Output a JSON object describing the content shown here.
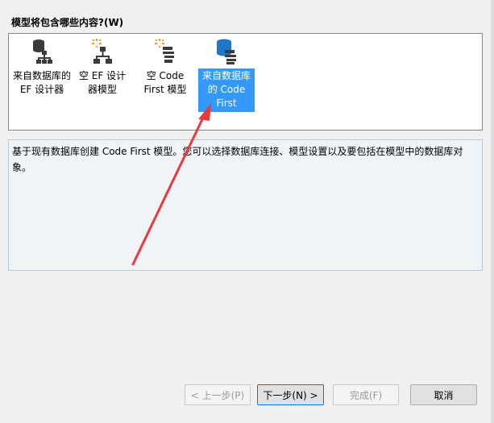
{
  "prompt": {
    "question": "模型将包含哪些内容?(W)"
  },
  "choices": [
    {
      "label": "来自数据库的 EF 设计器",
      "icon": "database-diagram-icon",
      "selected": false
    },
    {
      "label": "空 EF 设计器模型",
      "icon": "empty-diagram-icon",
      "selected": false
    },
    {
      "label": "空 Code First 模型",
      "icon": "code-first-icon",
      "selected": false
    },
    {
      "label": "来自数据库的 Code First",
      "icon": "database-code-first-icon",
      "selected": true
    }
  ],
  "description": "基于现有数据库创建 Code First 模型。您可以选择数据库连接、模型设置以及要包括在模型中的数据库对象。",
  "buttons": {
    "prev": "< 上一步(P)",
    "next": "下一步(N) >",
    "finish": "完成(F)",
    "cancel": "取消"
  },
  "colors": {
    "selection": "#3399ff",
    "annotation": "#e8393c"
  }
}
